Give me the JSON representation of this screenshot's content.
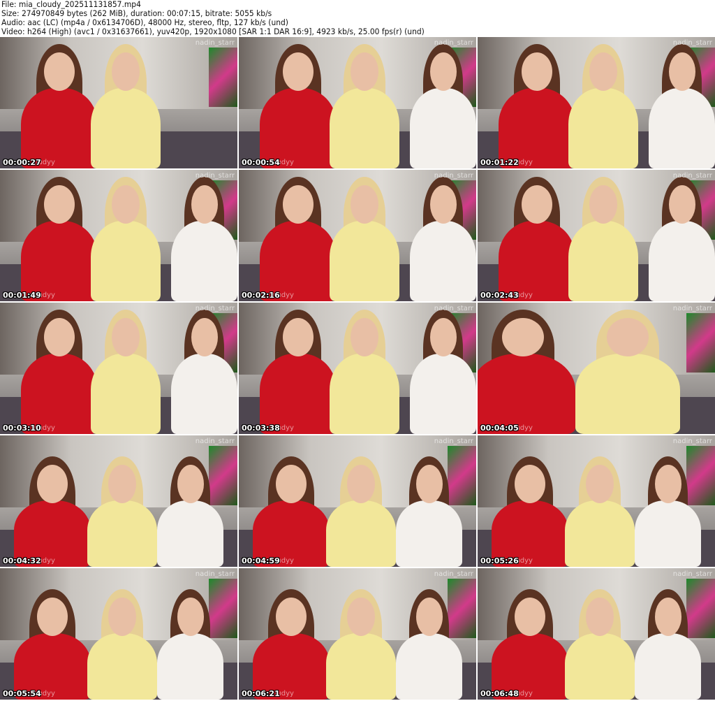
{
  "info": {
    "file": "File: mia_cloudy_202511131857.mp4",
    "size": "Size: 274970849 bytes (262 MiB), duration: 00:07:15, bitrate: 5055 kb/s",
    "audio": "Audio: aac (LC) (mp4a / 0x6134706D), 48000 Hz, stereo, fltp, 127 kb/s (und)",
    "video": "Video: h264 (High) (avc1 / 0x31637661), yuv420p, 1920x1080 [SAR 1:1 DAR 16:9], 4923 kb/s, 25.00 fps(r) (und)"
  },
  "watermark_top": "nadin_starr",
  "watermark_bottom": "cloudyy",
  "thumbnails": [
    {
      "time": "00:00:27"
    },
    {
      "time": "00:00:54"
    },
    {
      "time": "00:01:22"
    },
    {
      "time": "00:01:49"
    },
    {
      "time": "00:02:16"
    },
    {
      "time": "00:02:43"
    },
    {
      "time": "00:03:10"
    },
    {
      "time": "00:03:38"
    },
    {
      "time": "00:04:05"
    },
    {
      "time": "00:04:32"
    },
    {
      "time": "00:04:59"
    },
    {
      "time": "00:05:26"
    },
    {
      "time": "00:05:54"
    },
    {
      "time": "00:06:21"
    },
    {
      "time": "00:06:48"
    }
  ]
}
